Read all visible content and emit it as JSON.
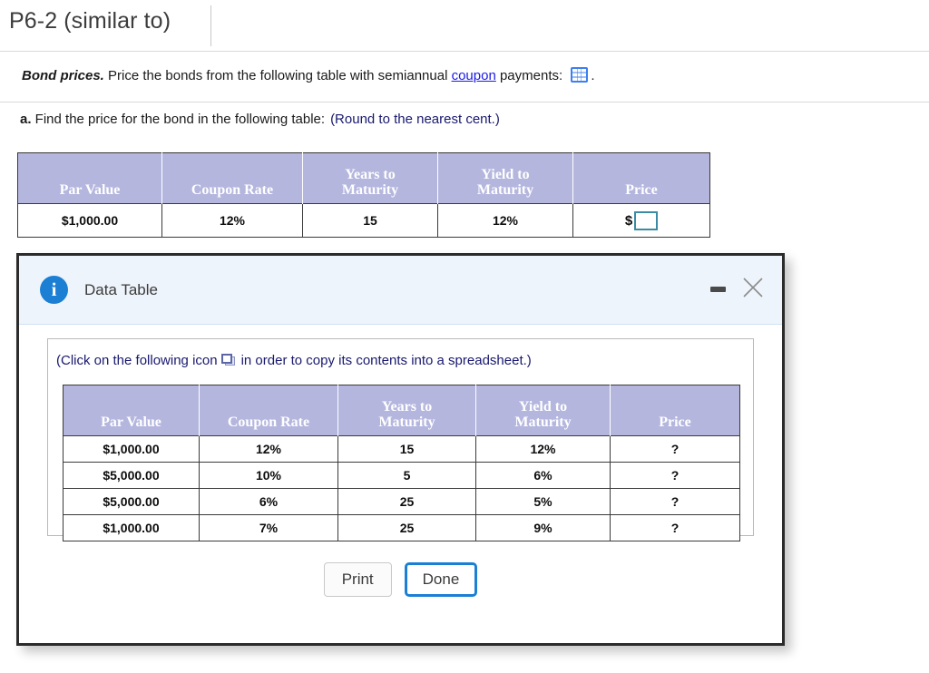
{
  "problem": {
    "title": "P6-2 (similar to)",
    "statement_lead": "Bond prices.",
    "statement_rest_1": " Price the bonds from the following table with semiannual ",
    "statement_link": "coupon",
    "statement_rest_2": " payments: ",
    "statement_icon": "grid-icon",
    "statement_period": ".",
    "part_label": "a.",
    "part_text": " Find the price for the bond in the following table:",
    "part_note": "(Round to the nearest cent.)"
  },
  "outer_table": {
    "headers": [
      "Par Value",
      "Coupon Rate",
      "Years to Maturity",
      "Yield to Maturity",
      "Price"
    ],
    "headers_line1": [
      "",
      "",
      "Years to",
      "Yield to",
      ""
    ],
    "headers_line2": [
      "Par Value",
      "Coupon Rate",
      "Maturity",
      "Maturity",
      "Price"
    ],
    "row": {
      "par_value": "$1,000.00",
      "coupon_rate": "12%",
      "years_to_maturity": "15",
      "yield_to_maturity": "12%",
      "price_prefix": "$",
      "price_value": ""
    }
  },
  "dialog": {
    "icon": "info-icon",
    "title": "Data Table",
    "minimize_label": "minimize",
    "close_label": "close",
    "copy_note_part1": "(Click on the following icon",
    "copy_icon": "copy-icon",
    "copy_note_part2": "in order to copy its contents into a spreadsheet.)",
    "buttons": {
      "print": "Print",
      "done": "Done"
    },
    "table": {
      "headers_line1": [
        "",
        "",
        "Years to",
        "Yield to",
        ""
      ],
      "headers_line2": [
        "Par Value",
        "Coupon Rate",
        "Maturity",
        "Maturity",
        "Price"
      ],
      "rows": [
        [
          "$1,000.00",
          "12%",
          "15",
          "12%",
          "?"
        ],
        [
          "$5,000.00",
          "10%",
          "5",
          "6%",
          "?"
        ],
        [
          "$5,000.00",
          "6%",
          "25",
          "5%",
          "?"
        ],
        [
          "$1,000.00",
          "7%",
          "25",
          "9%",
          "?"
        ]
      ]
    }
  },
  "colors": {
    "table_header_bg": "#b4b6de",
    "dialog_header_bg": "#eef4fc",
    "accent_blue": "#1b7fd4",
    "link_blue": "#1a1ae6",
    "note_navy": "#191970",
    "input_border": "#3a8ba3"
  }
}
